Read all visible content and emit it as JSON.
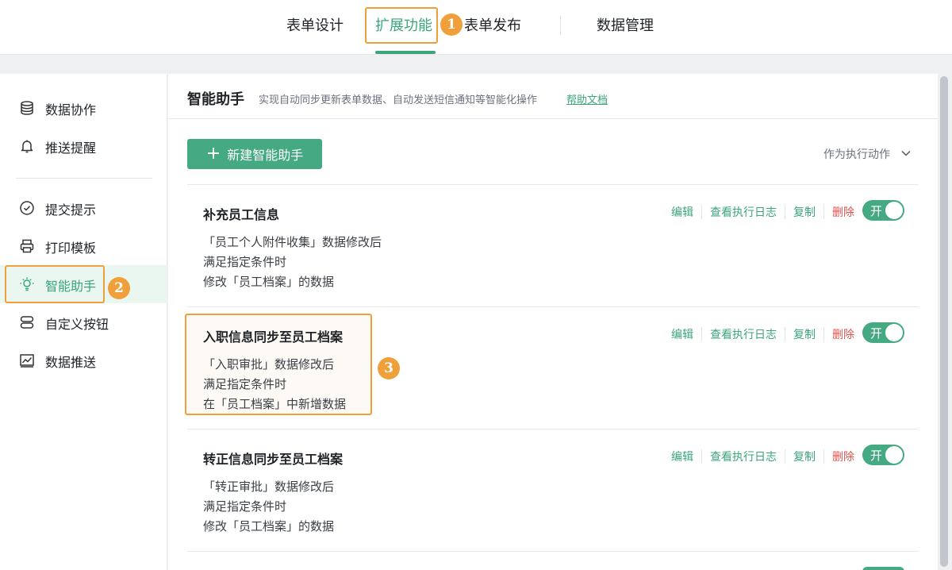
{
  "tabs": [
    {
      "label": "表单设计"
    },
    {
      "label": "扩展功能"
    },
    {
      "label": "表单发布"
    },
    {
      "label": "数据管理"
    }
  ],
  "badges": [
    "1",
    "2",
    "3"
  ],
  "sidebar": {
    "items": [
      {
        "label": "数据协作",
        "icon": "database-icon"
      },
      {
        "label": "推送提醒",
        "icon": "bell-icon"
      },
      {
        "label": "提交提示",
        "icon": "check-circle-icon"
      },
      {
        "label": "打印模板",
        "icon": "printer-icon"
      },
      {
        "label": "智能助手",
        "icon": "lightbulb-icon"
      },
      {
        "label": "自定义按钮",
        "icon": "buttons-icon"
      },
      {
        "label": "数据推送",
        "icon": "chart-icon"
      }
    ]
  },
  "main": {
    "title": "智能助手",
    "description": "实现自动同步更新表单数据、自动发送短信通知等智能化操作",
    "help_link": "帮助文档",
    "new_button": "新建智能助手",
    "filter_label": "作为执行动作"
  },
  "actions": {
    "edit": "编辑",
    "log": "查看执行日志",
    "copy": "复制",
    "delete": "删除",
    "toggle": "开"
  },
  "cards": [
    {
      "title": "补充员工信息",
      "lines": [
        "「员工个人附件收集」数据修改后",
        "满足指定条件时",
        "修改「员工档案」的数据"
      ]
    },
    {
      "title": "入职信息同步至员工档案",
      "lines": [
        "「入职审批」数据修改后",
        "满足指定条件时",
        "在「员工档案」中新增数据"
      ]
    },
    {
      "title": "转正信息同步至员工档案",
      "lines": [
        "「转正审批」数据修改后",
        "满足指定条件时",
        "修改「员工档案」的数据"
      ]
    }
  ],
  "colors": {
    "accent": "#3aa67a",
    "highlight": "#f0a03a",
    "danger": "#e0534c"
  }
}
